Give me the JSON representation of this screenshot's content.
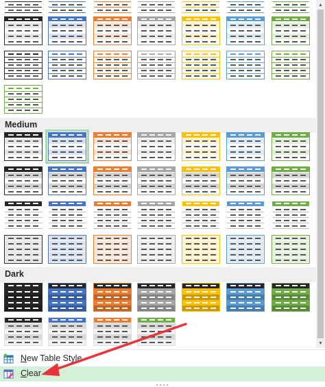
{
  "sections": [
    {
      "key": "light",
      "label": ""
    },
    {
      "key": "medium",
      "label": "Medium"
    },
    {
      "key": "dark",
      "label": "Dark"
    }
  ],
  "palette": {
    "black": "#262626",
    "blue": "#4472c4",
    "orange": "#ed7d31",
    "gray": "#a5a5a5",
    "gold": "#ffc000",
    "lightblue": "#5b9bd5",
    "green": "#70ad47"
  },
  "scrollbar": {
    "up_icon": "triangle-up",
    "down_icon": "triangle-down"
  },
  "menu": {
    "new_style": {
      "underlined": "N",
      "rest": "ew Table Style",
      "icon": "table-new-icon"
    },
    "clear": {
      "underlined": "C",
      "rest": "lear",
      "icon": "table-clear-icon"
    }
  },
  "annotation": {
    "arrow_color": "#e8333a"
  }
}
